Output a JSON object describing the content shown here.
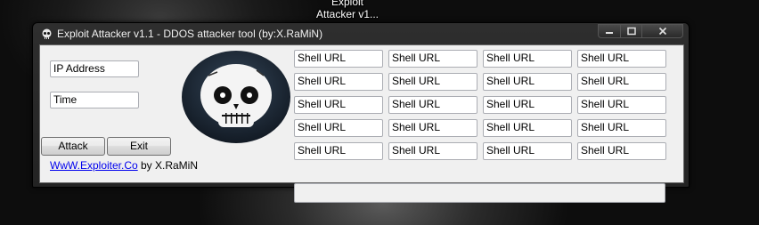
{
  "desktop": {
    "icon_label": "Exploit\nAttacker v1..."
  },
  "window": {
    "title": "Exploit Attacker v1.1 - DDOS attacker tool (by:X.RaMiN)",
    "controls": {
      "minimize": "minimize",
      "maximize": "maximize",
      "close": "close"
    }
  },
  "form": {
    "ip_address": "IP Address",
    "time": "Time",
    "attack_label": "Attack",
    "exit_label": "Exit",
    "website_link": "WwW.Exploiter.Co",
    "author": "by X.RaMiN"
  },
  "shell_urls": [
    [
      "Shell URL",
      "Shell URL",
      "Shell URL",
      "Shell URL"
    ],
    [
      "Shell URL",
      "Shell URL",
      "Shell URL",
      "Shell URL"
    ],
    [
      "Shell URL",
      "Shell URL",
      "Shell URL",
      "Shell URL"
    ],
    [
      "Shell URL",
      "Shell URL",
      "Shell URL",
      "Shell URL"
    ],
    [
      "Shell URL",
      "Shell URL",
      "Shell URL",
      "Shell URL"
    ]
  ],
  "status": "",
  "icons": {
    "app": "skull-icon",
    "logo": "skull-hood-icon"
  },
  "colors": {
    "client_bg": "#f0f0f0",
    "titlebar": "#2e2e2e",
    "link": "#0000ee",
    "skull_hood": "#1e2a38"
  }
}
